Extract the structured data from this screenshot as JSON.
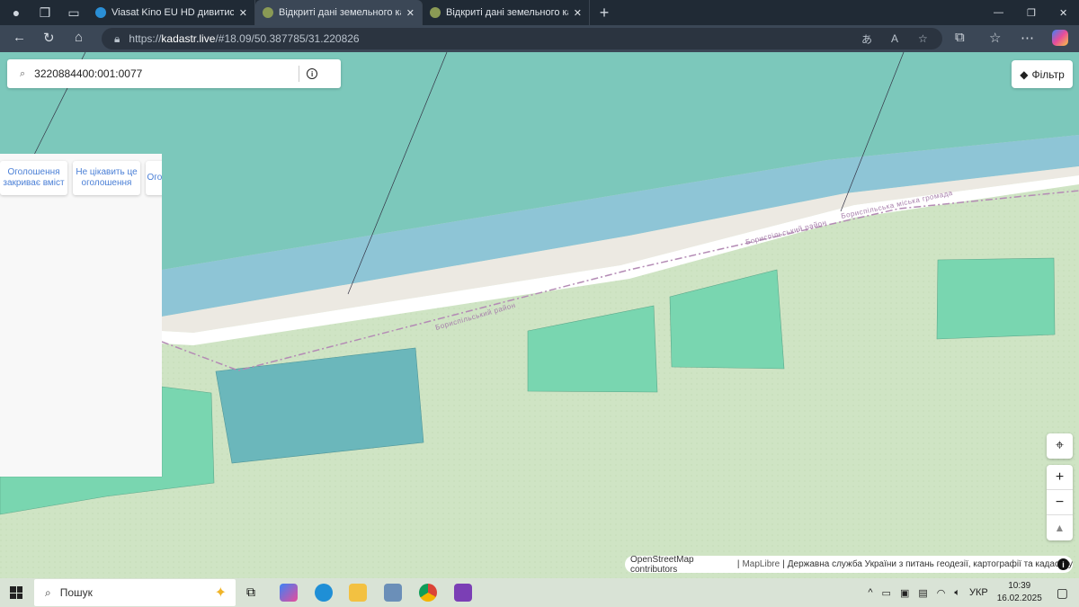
{
  "browser": {
    "tabs": [
      {
        "title": "Viasat Kino EU HD дивитися на S",
        "active": false
      },
      {
        "title": "Відкриті дані земельного кадаст",
        "active": true
      },
      {
        "title": "Відкриті дані земельного кадаст",
        "active": false
      }
    ],
    "url_prefix": "https://",
    "url_host": "kadastr.live",
    "url_rest": "/#18.09/50.387785/31.220826"
  },
  "search": {
    "value": "3220884400:001:0077"
  },
  "filter_label": "Фільтр",
  "ads": [
    "Оголошення закриває вміст",
    "Не цікавить це оголошення",
    "Оголошення не"
  ],
  "map": {
    "labels": [
      "Бориспільський район",
      "Бориспільський район",
      "Бориспільська міська громада"
    ],
    "colors": {
      "water": "#7cc8bb",
      "river": "#8ec5d6",
      "land": "#cfe4c4",
      "parcel": "#79d6b0",
      "selected": "#6bb7bb",
      "boundary": "#b48bb5"
    }
  },
  "attribution": {
    "osm": "OpenStreetMap contributors",
    "maplibre": "MapLibre",
    "gov": "Державна служба України з питань геодезії, картографії та кадастру"
  },
  "taskbar": {
    "search_placeholder": "Пошук",
    "lang": "УКР",
    "time": "10:39",
    "date": "16.02.2025"
  }
}
